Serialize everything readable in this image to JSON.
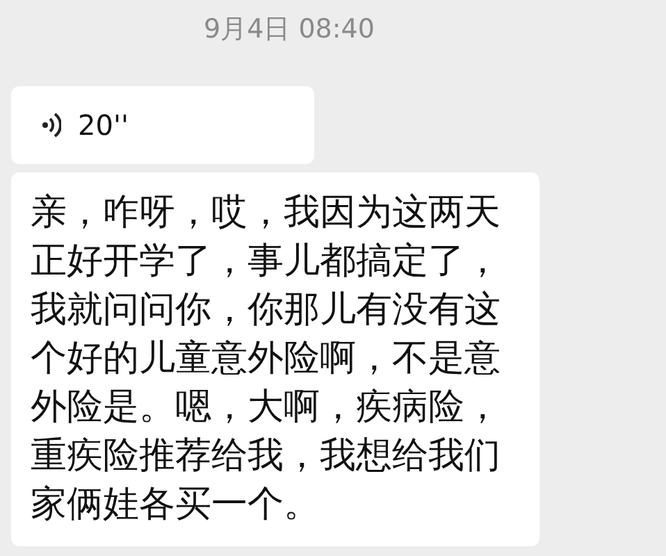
{
  "timestamp": "9月4日 08:40",
  "messages": [
    {
      "kind": "voice",
      "duration": "20''"
    },
    {
      "kind": "text",
      "text": "亲，咋呀，哎，我因为这两天正好开学了，事儿都搞定了，我就问问你，你那儿有没有这个好的儿童意外险啊，不是意外险是。嗯，大啊，疾病险，重疾险推荐给我，我想给我们家俩娃各买一个。"
    }
  ]
}
